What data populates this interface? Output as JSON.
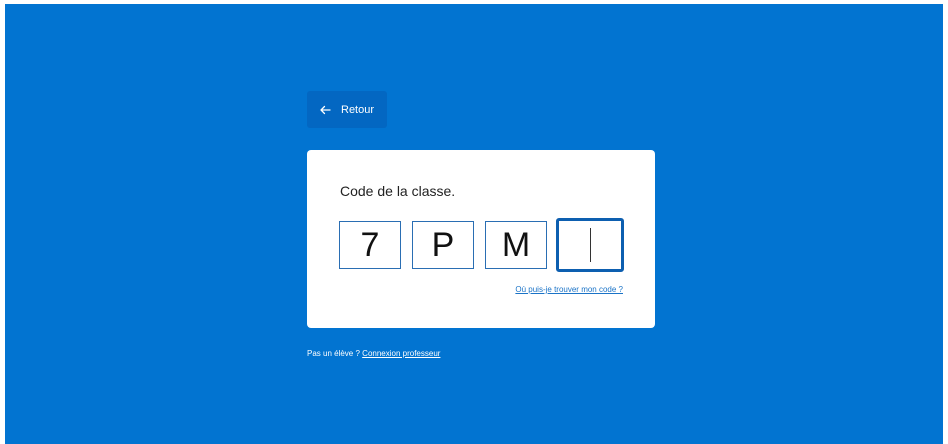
{
  "back_button": {
    "label": "Retour",
    "icon": "arrow-left-icon"
  },
  "card": {
    "title": "Code de la classe.",
    "code_chars": [
      "7",
      "P",
      "M",
      ""
    ],
    "help_link": "Où puis-je trouver mon code ?"
  },
  "footer": {
    "prefix": "Pas un élève ?",
    "link": "Connexion professeur"
  },
  "colors": {
    "background": "#0274d1",
    "back_button_bg": "#0367c2",
    "box_border": "#2a6eb3",
    "link": "#1a73c7"
  }
}
